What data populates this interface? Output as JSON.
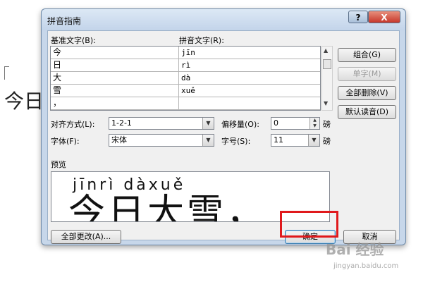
{
  "document": {
    "text": "今日"
  },
  "dialog": {
    "title": "拼音指南",
    "help": "?",
    "close": "X",
    "base_label": "基准文字(B):",
    "ruby_label": "拼音文字(R):",
    "rows": [
      {
        "base": "今",
        "ruby": "jīn"
      },
      {
        "base": "日",
        "ruby": "rì"
      },
      {
        "base": "大",
        "ruby": "dà"
      },
      {
        "base": "雪",
        "ruby": "xuě"
      },
      {
        "base": "，",
        "ruby": ""
      }
    ],
    "buttons": {
      "group": "组合(G)",
      "mono": "单字(M)",
      "clear_all": "全部删除(V)",
      "default_reading": "默认读音(D)",
      "change_all": "全部更改(A)...",
      "ok": "确定",
      "cancel": "取消"
    },
    "alignment": {
      "label": "对齐方式(L):",
      "value": "1-2-1"
    },
    "offset": {
      "label": "偏移量(O):",
      "value": "0",
      "unit": "磅"
    },
    "font": {
      "label": "字体(F):",
      "value": "宋体"
    },
    "size": {
      "label": "字号(S):",
      "value": "11",
      "unit": "磅"
    },
    "preview": {
      "label": "预览",
      "pinyin": "jīnrì dàxuě",
      "text": "今日大雪，"
    }
  },
  "watermark": {
    "main": "Bai 经验",
    "sub": "jingyan.baidu.com"
  }
}
